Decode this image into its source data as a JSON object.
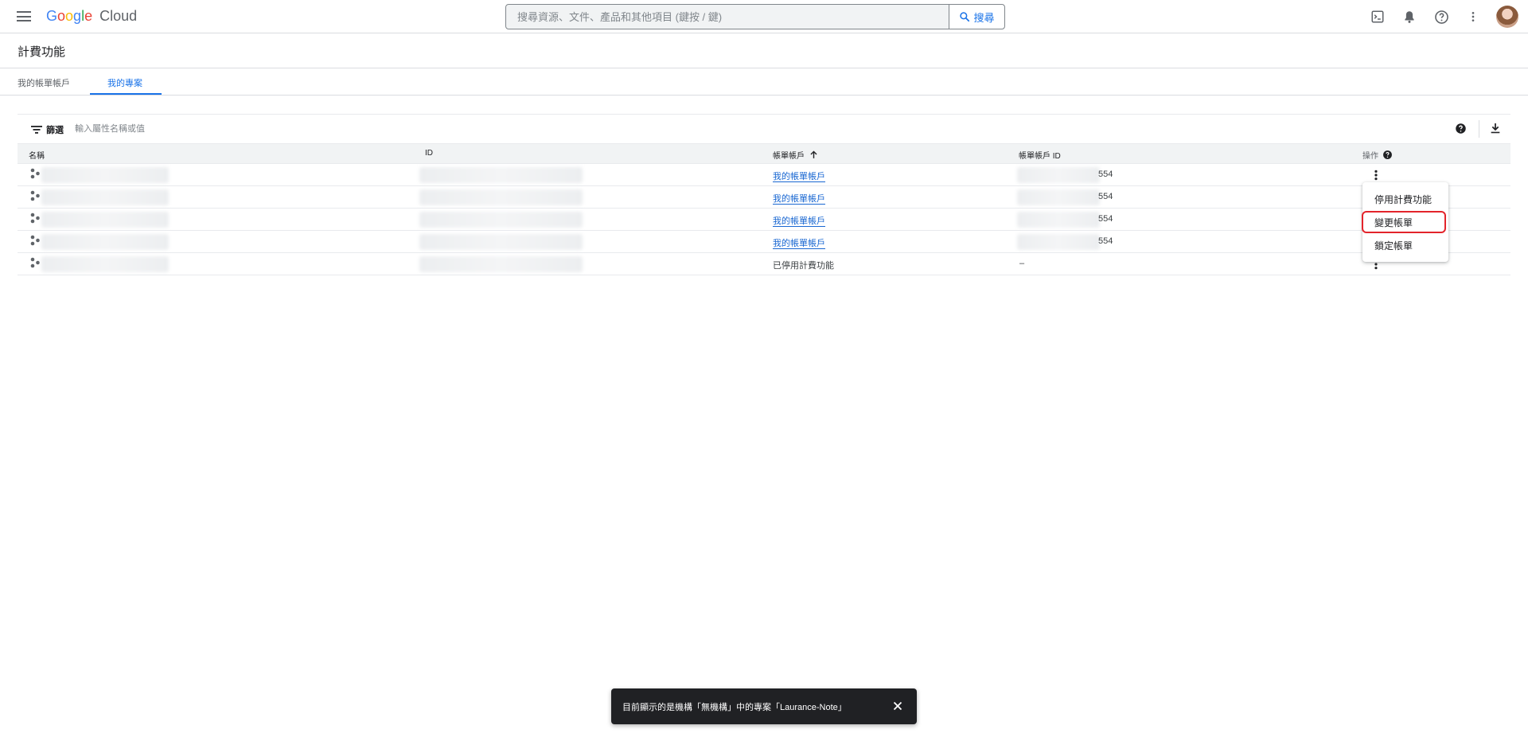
{
  "header": {
    "logo_google": "Google",
    "logo_cloud": "Cloud",
    "search_placeholder": "搜尋資源、文件、產品和其他項目 (鍵按 / 鍵)",
    "search_button": "搜尋",
    "icons": [
      "menu-icon",
      "terminal-icon",
      "bell-icon",
      "help-icon",
      "more-vert-icon"
    ]
  },
  "page": {
    "title": "計費功能"
  },
  "tabs": [
    {
      "label": "我的帳單帳戶",
      "active": false
    },
    {
      "label": "我的專案",
      "active": true
    }
  ],
  "filter": {
    "label": "篩選",
    "placeholder": "輸入屬性名稱或值"
  },
  "table": {
    "columns": [
      "名稱",
      "ID",
      "帳單帳戶",
      "帳單帳戶 ID",
      "操作"
    ],
    "sort_column": "帳單帳戶",
    "sort_direction": "ascending",
    "rows": [
      {
        "name": "",
        "id": "",
        "billing_account": "我的帳單帳戶",
        "billing_account_id": "554",
        "billing_linked": true
      },
      {
        "name": "",
        "id": "",
        "billing_account": "我的帳單帳戶",
        "billing_account_id": "554",
        "billing_linked": true
      },
      {
        "name": "",
        "id": "",
        "billing_account": "我的帳單帳戶",
        "billing_account_id": "554",
        "billing_linked": true
      },
      {
        "name": "",
        "id": "",
        "billing_account": "我的帳單帳戶",
        "billing_account_id": "554",
        "billing_linked": true
      },
      {
        "name": "",
        "id": "",
        "billing_account": "已停用計費功能",
        "billing_account_id": "–",
        "billing_linked": false
      }
    ]
  },
  "actions_menu": {
    "items": [
      "停用計費功能",
      "變更帳單",
      "鎖定帳單"
    ],
    "highlighted": "變更帳單"
  },
  "snackbar": {
    "text": "目前顯示的是機構「無機構」中的專案「Laurance-Note」"
  },
  "colors": {
    "accent": "#1a73e8",
    "highlight_border": "#e3242b",
    "snackbar_bg": "#202124"
  }
}
